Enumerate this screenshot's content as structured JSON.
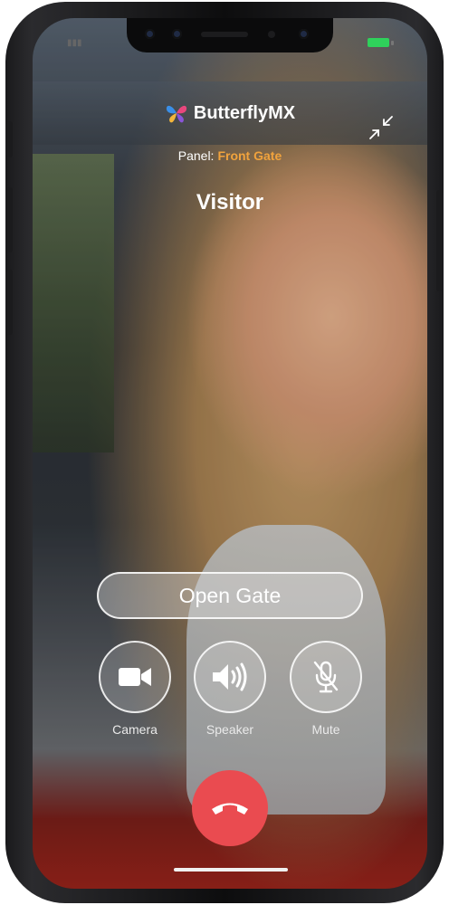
{
  "header": {
    "brand_name": "ButterflyMX",
    "panel_label": "Panel:",
    "panel_value": "Front Gate",
    "caller_name": "Visitor"
  },
  "actions": {
    "open_gate_label": "Open Gate"
  },
  "controls": [
    {
      "label": "Camera",
      "icon": "video-camera-icon"
    },
    {
      "label": "Speaker",
      "icon": "speaker-icon"
    },
    {
      "label": "Mute",
      "icon": "microphone-off-icon"
    }
  ],
  "hangup": {
    "icon": "phone-hangup-icon"
  },
  "colors": {
    "panel_value": "#f1a33d",
    "hangup": "#ea4b50",
    "battery": "#2fd15b"
  }
}
